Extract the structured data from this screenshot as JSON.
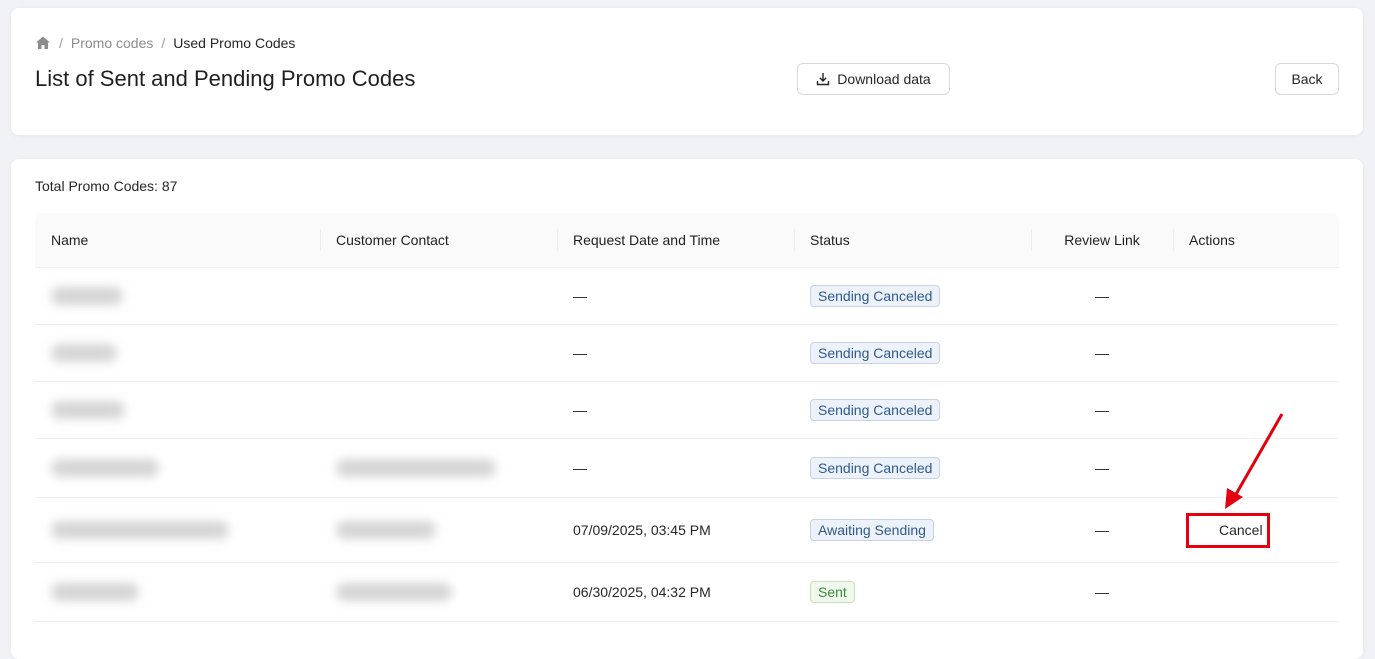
{
  "breadcrumb": {
    "items": [
      {
        "label": "Promo codes"
      },
      {
        "label": "Used Promo Codes"
      }
    ]
  },
  "page": {
    "title": "List of Sent and Pending Promo Codes",
    "download_label": "Download data",
    "back_label": "Back"
  },
  "summary": {
    "total_text": "Total Promo Codes: 87"
  },
  "table": {
    "columns": [
      "Name",
      "Customer Contact",
      "Request Date and Time",
      "Status",
      "Review Link",
      "Actions"
    ],
    "rows": [
      {
        "date": "—",
        "status": "Sending Canceled",
        "review": "—",
        "action": ""
      },
      {
        "date": "—",
        "status": "Sending Canceled",
        "review": "—",
        "action": ""
      },
      {
        "date": "—",
        "status": "Sending Canceled",
        "review": "—",
        "action": ""
      },
      {
        "date": "—",
        "status": "Sending Canceled",
        "review": "—",
        "action": ""
      },
      {
        "date": "07/09/2025, 03:45 PM",
        "status": "Awaiting Sending",
        "review": "—",
        "action": "Cancel"
      },
      {
        "date": "06/30/2025, 04:32 PM",
        "status": "Sent",
        "review": "—",
        "action": ""
      }
    ]
  },
  "colors": {
    "annotation_red": "#e3000f",
    "tag_blue": "#2f5a8e",
    "tag_green": "#3a8a3a"
  }
}
